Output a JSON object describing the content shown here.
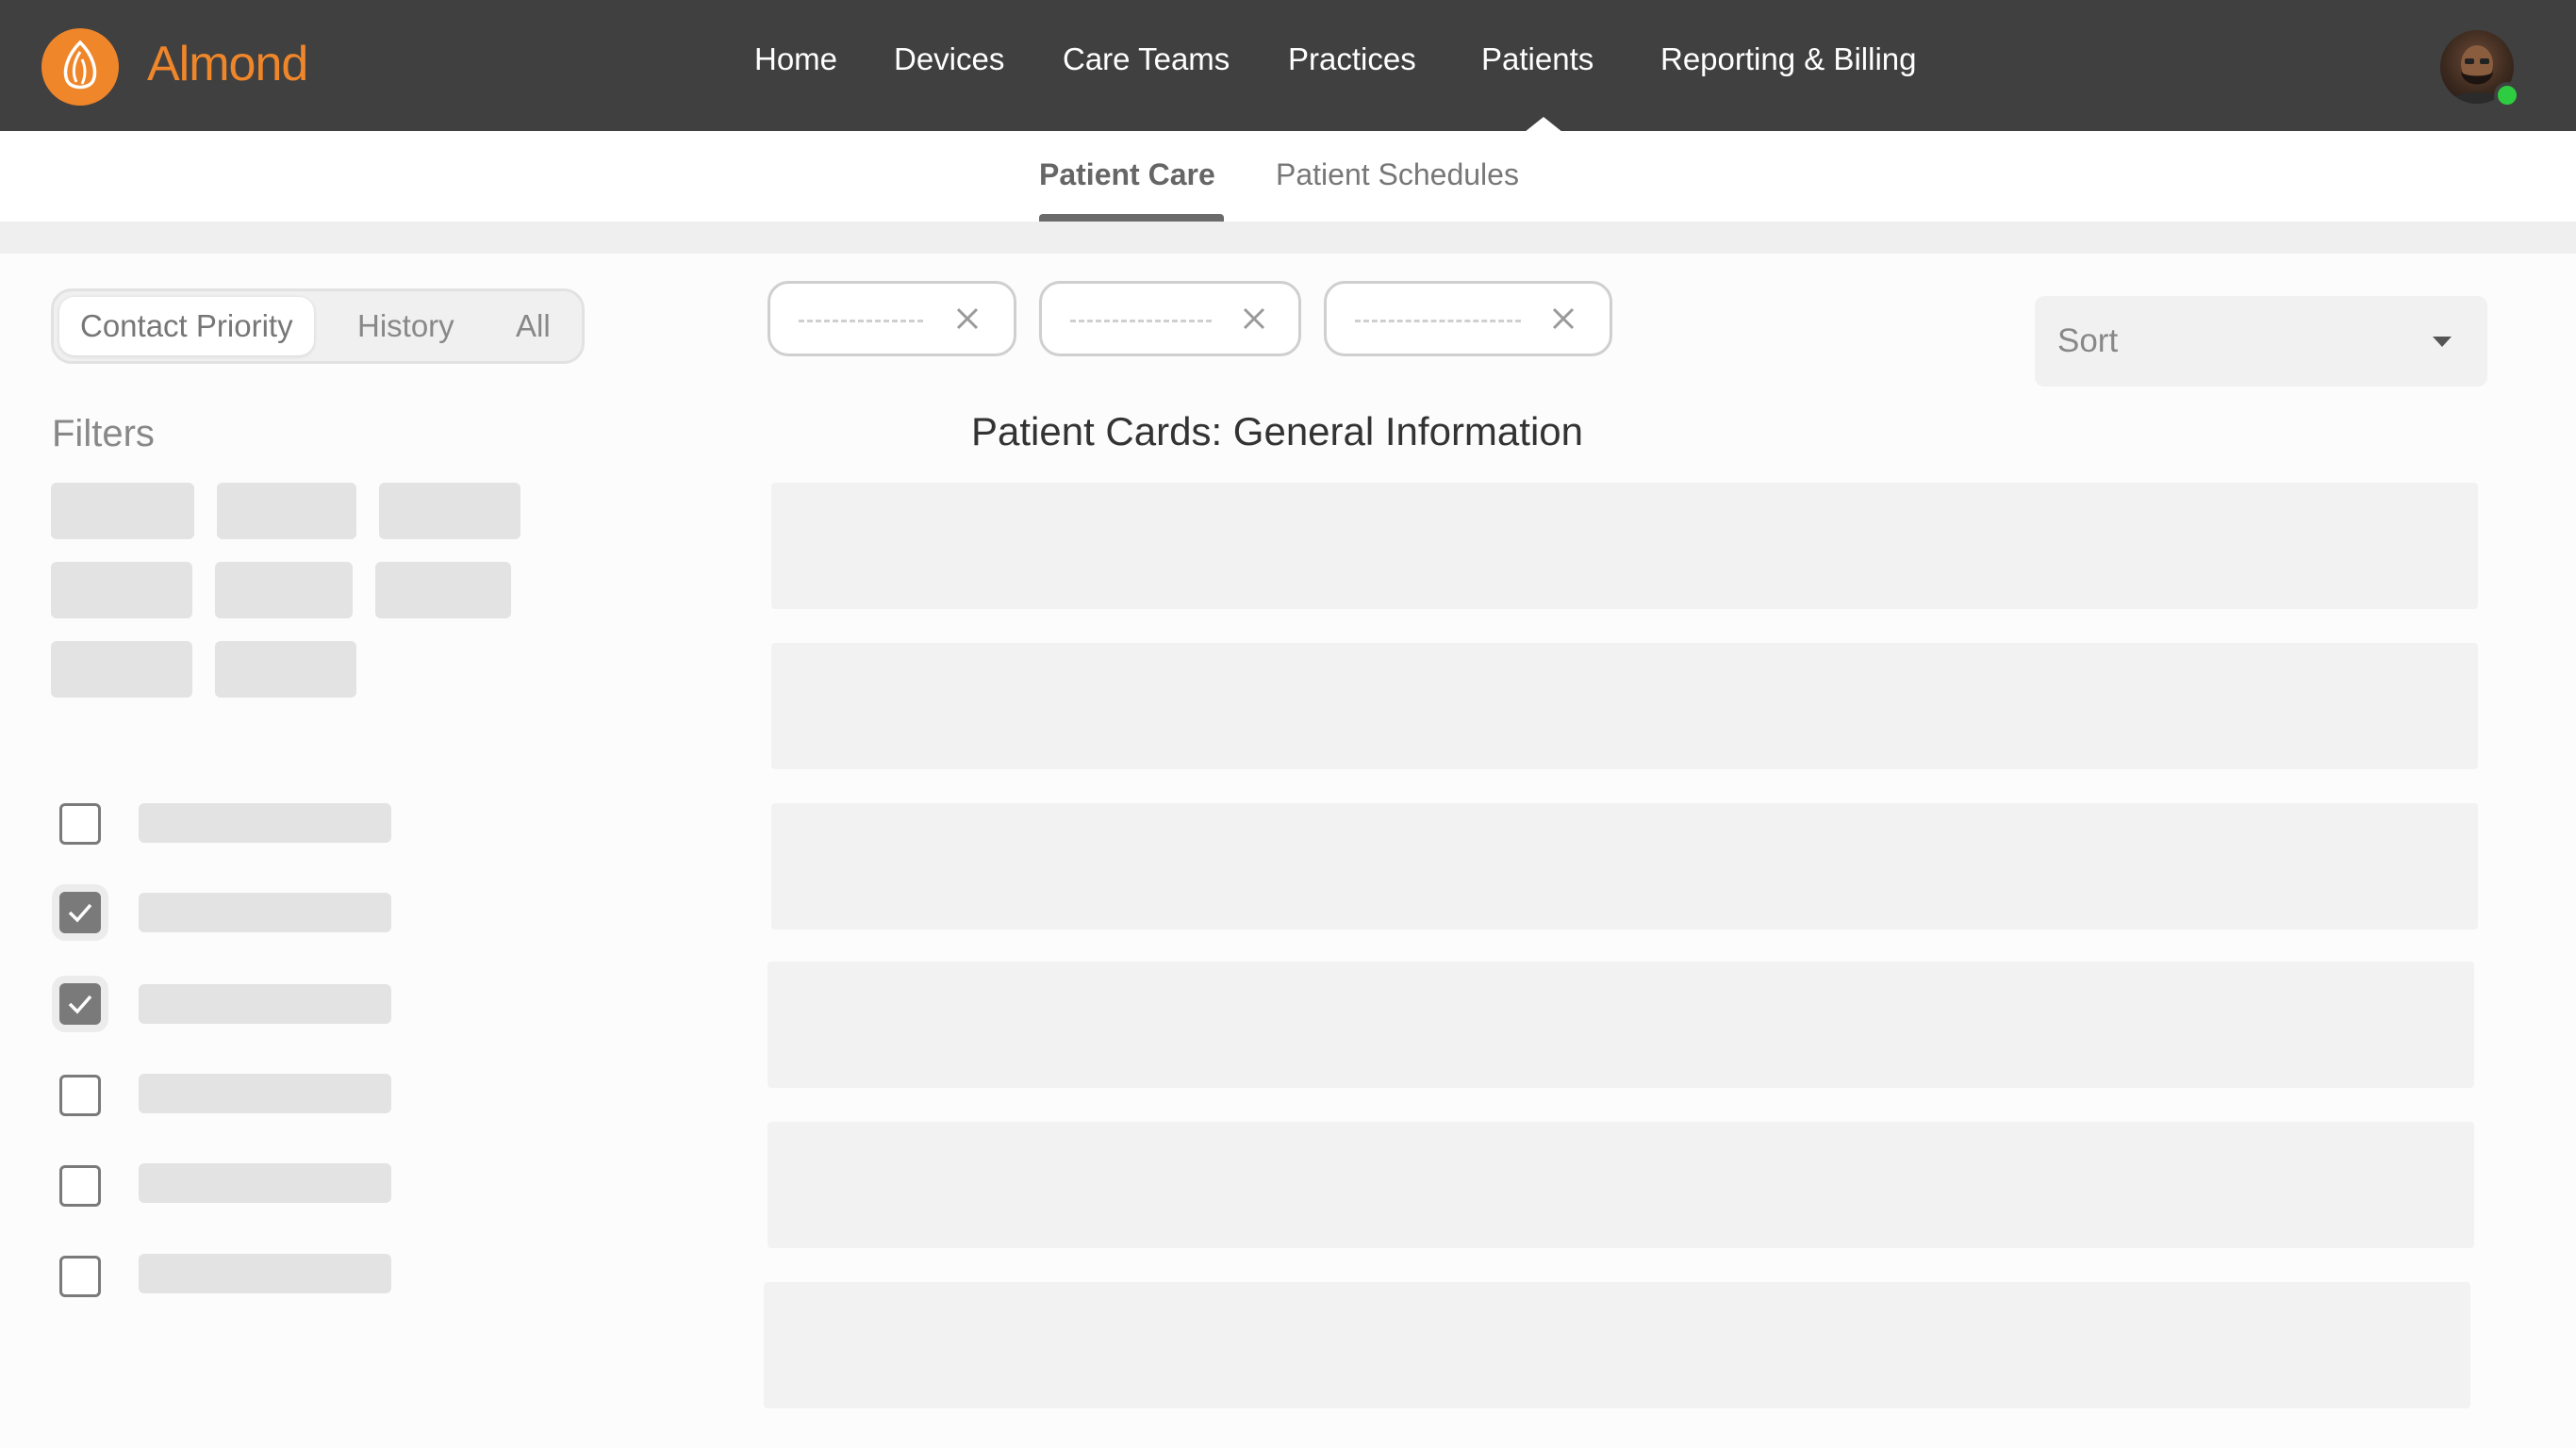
{
  "brand": {
    "name": "Almond",
    "accent": "#f0862a",
    "logo_icon": "almond-logo-icon"
  },
  "nav": {
    "items": [
      "Home",
      "Devices",
      "Care Teams",
      "Practices",
      "Patients",
      "Reporting & Billing"
    ],
    "active": "Patients"
  },
  "user": {
    "avatar": "user-avatar",
    "status": "online",
    "status_color": "#2ecc40"
  },
  "subnav": {
    "tabs": [
      "Patient Care",
      "Patient Schedules"
    ],
    "active": "Patient Care"
  },
  "segment": {
    "options": [
      "Contact Priority",
      "History",
      "All"
    ],
    "active": "Contact Priority"
  },
  "filters": {
    "title": "Filters",
    "checkboxes": [
      false,
      true,
      true,
      false,
      false,
      false
    ]
  },
  "sort": {
    "label": "Sort"
  },
  "cards": {
    "title": "Patient Cards: General Information",
    "count": 6
  }
}
